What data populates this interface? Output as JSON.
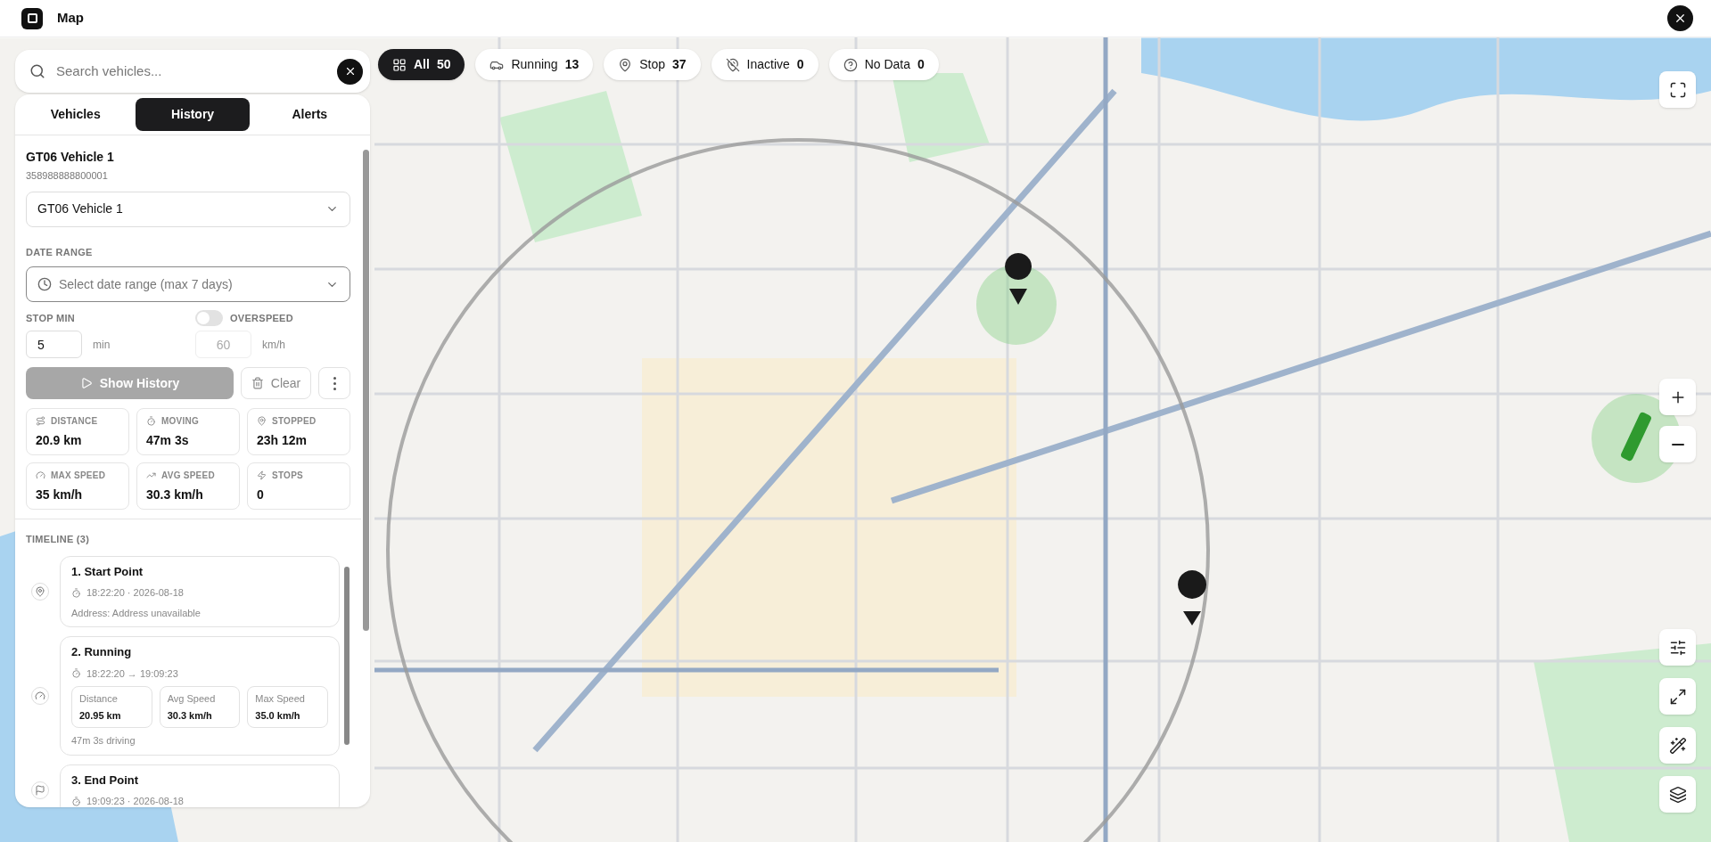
{
  "header": {
    "title": "Map"
  },
  "search": {
    "placeholder": "Search vehicles..."
  },
  "filters": [
    {
      "kind": "all",
      "label": "All",
      "count": "50",
      "selected": true
    },
    {
      "kind": "running",
      "label": "Running",
      "count": "13",
      "selected": false
    },
    {
      "kind": "stop",
      "label": "Stop",
      "count": "37",
      "selected": false
    },
    {
      "kind": "inactive",
      "label": "Inactive",
      "count": "0",
      "selected": false
    },
    {
      "kind": "nodata",
      "label": "No Data",
      "count": "0",
      "selected": false
    }
  ],
  "tabs": [
    {
      "label": "Vehicles",
      "selected": false
    },
    {
      "label": "History",
      "selected": true
    },
    {
      "label": "Alerts",
      "selected": false
    }
  ],
  "vehicle": {
    "name": "GT06 Vehicle 1",
    "imei": "358988888800001",
    "select_value": "GT06 Vehicle 1"
  },
  "date_range": {
    "label": "DATE RANGE",
    "placeholder": "Select date range (max 7 days)"
  },
  "stop_min": {
    "label": "STOP MIN",
    "value": "5",
    "unit": "min"
  },
  "overspeed": {
    "label": "OVERSPEED",
    "on": false,
    "placeholder": "60",
    "unit": "km/h",
    "disabled": true
  },
  "show_history": {
    "label": "Show History",
    "disabled": true
  },
  "clear": {
    "label": "Clear"
  },
  "stats": [
    {
      "kind": "distance",
      "label": "DISTANCE",
      "value": "20.9 km"
    },
    {
      "kind": "moving",
      "label": "MOVING",
      "value": "47m 3s"
    },
    {
      "kind": "stopped",
      "label": "STOPPED",
      "value": "23h 12m"
    },
    {
      "kind": "max_speed",
      "label": "MAX SPEED",
      "value": "35 km/h"
    },
    {
      "kind": "avg_speed",
      "label": "AVG SPEED",
      "value": "30.3 km/h"
    },
    {
      "kind": "stops",
      "label": "STOPS",
      "value": "0"
    }
  ],
  "timeline": {
    "label": "TIMELINE (3)",
    "items": [
      {
        "kind": "start",
        "title": "1. Start Point",
        "time": "18:22:20 · 2026-08-18",
        "address": "Address: Address unavailable"
      },
      {
        "kind": "running",
        "title": "2. Running",
        "time": "18:22:20 → 19:09:23",
        "metrics": [
          {
            "label": "Distance",
            "value": "20.95 km"
          },
          {
            "label": "Avg Speed",
            "value": "30.3 km/h"
          },
          {
            "label": "Max Speed",
            "value": "35.0 km/h"
          }
        ],
        "footer": "47m 3s driving"
      },
      {
        "kind": "end",
        "title": "3. End Point",
        "time": "19:09:23 · 2026-08-18"
      }
    ]
  }
}
